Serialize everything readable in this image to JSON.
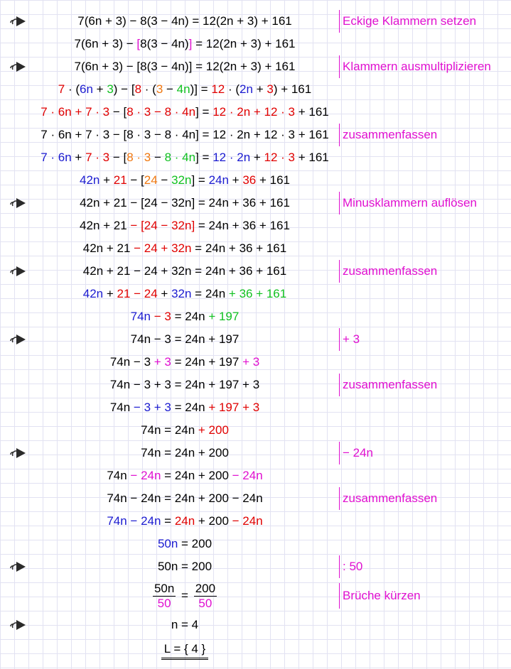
{
  "colors": {
    "black": "#000000",
    "red": "#e00000",
    "blue": "#1a1ad0",
    "green": "#10c020",
    "orange": "#f07810",
    "magenta": "#e010d0",
    "grid": "#e2e2f2",
    "icon": "#2a2a2a"
  },
  "rows": [
    {
      "icon": true,
      "segs": [
        [
          "7(6n + 3) − 8(3 − 4n) = 12(2n + 3) + 161",
          "black"
        ]
      ],
      "ann": "Eckige Klammern setzen"
    },
    {
      "icon": false,
      "segs": [
        [
          "7(6n + 3) − ",
          "black"
        ],
        [
          "[",
          "magenta"
        ],
        [
          "8(3 − 4n)",
          "black"
        ],
        [
          "]",
          "magenta"
        ],
        [
          " = 12(2n + 3) + 161",
          "black"
        ]
      ],
      "ann": ""
    },
    {
      "icon": true,
      "segs": [
        [
          "7(6n + 3) − [8(3 − 4n)] = 12(2n + 3) + 161",
          "black"
        ]
      ],
      "ann": "Klammern ausmultiplizieren"
    },
    {
      "icon": false,
      "segs": [
        [
          "7",
          "red"
        ],
        [
          " · (",
          "black"
        ],
        [
          "6n",
          "blue"
        ],
        [
          " + ",
          "black"
        ],
        [
          "3",
          "green"
        ],
        [
          ") − [",
          "black"
        ],
        [
          "8",
          "red"
        ],
        [
          " · (",
          "black"
        ],
        [
          "3",
          "orange"
        ],
        [
          " − ",
          "black"
        ],
        [
          "4n",
          "green"
        ],
        [
          ")] = ",
          "black"
        ],
        [
          "12",
          "red"
        ],
        [
          " · (",
          "black"
        ],
        [
          "2n",
          "blue"
        ],
        [
          " + ",
          "black"
        ],
        [
          "3",
          "red"
        ],
        [
          ") + 161",
          "black"
        ]
      ],
      "ann": ""
    },
    {
      "icon": false,
      "segs": [
        [
          "7 · 6n + 7 · 3",
          "red"
        ],
        [
          " − [",
          "black"
        ],
        [
          "8 · 3 − 8 · 4n",
          "red"
        ],
        [
          "] = ",
          "black"
        ],
        [
          "12 · 2n + 12 · 3",
          "red"
        ],
        [
          " + 161",
          "black"
        ]
      ],
      "ann": ""
    },
    {
      "icon": false,
      "segs": [
        [
          "7 · 6n + 7 · 3 − [8 · 3 − 8 · 4n] = 12 · 2n + 12 · 3 + 161",
          "black"
        ]
      ],
      "ann": "zusammenfassen"
    },
    {
      "icon": false,
      "segs": [
        [
          "7 · 6n",
          "blue"
        ],
        [
          " + ",
          "black"
        ],
        [
          "7 · 3",
          "red"
        ],
        [
          " − [",
          "black"
        ],
        [
          "8 · 3",
          "orange"
        ],
        [
          " − ",
          "black"
        ],
        [
          "8 · 4n",
          "green"
        ],
        [
          "] = ",
          "black"
        ],
        [
          "12 · 2n",
          "blue"
        ],
        [
          " + ",
          "black"
        ],
        [
          "12 · 3",
          "red"
        ],
        [
          " + 161",
          "black"
        ]
      ],
      "ann": ""
    },
    {
      "icon": false,
      "segs": [
        [
          "42n",
          "blue"
        ],
        [
          " + ",
          "black"
        ],
        [
          "21",
          "red"
        ],
        [
          " − [",
          "black"
        ],
        [
          "24",
          "orange"
        ],
        [
          " − ",
          "black"
        ],
        [
          "32n",
          "green"
        ],
        [
          "] = ",
          "black"
        ],
        [
          "24n",
          "blue"
        ],
        [
          " + ",
          "black"
        ],
        [
          "36",
          "red"
        ],
        [
          " + 161",
          "black"
        ]
      ],
      "ann": ""
    },
    {
      "icon": true,
      "segs": [
        [
          "42n + 21 − [24 − 32n] = 24n + 36 + 161",
          "black"
        ]
      ],
      "ann": "Minusklammern auflösen"
    },
    {
      "icon": false,
      "segs": [
        [
          "42n + 21 ",
          "black"
        ],
        [
          "− [24 − 32n]",
          "red"
        ],
        [
          " = 24n + 36 + 161",
          "black"
        ]
      ],
      "ann": ""
    },
    {
      "icon": false,
      "segs": [
        [
          "42n + 21 ",
          "black"
        ],
        [
          "− 24 + 32n",
          "red"
        ],
        [
          " = 24n + 36 + 161",
          "black"
        ]
      ],
      "ann": ""
    },
    {
      "icon": true,
      "segs": [
        [
          "42n + 21 − 24 + 32n = 24n + 36 + 161",
          "black"
        ]
      ],
      "ann": "zusammenfassen"
    },
    {
      "icon": false,
      "segs": [
        [
          "42n",
          "blue"
        ],
        [
          " + ",
          "black"
        ],
        [
          "21 − 24",
          "red"
        ],
        [
          " + ",
          "black"
        ],
        [
          "32n",
          "blue"
        ],
        [
          " = 24n ",
          "black"
        ],
        [
          "+ 36 + 161",
          "green"
        ]
      ],
      "ann": ""
    },
    {
      "icon": false,
      "segs": [
        [
          "74n",
          "blue"
        ],
        [
          " ",
          "black"
        ],
        [
          "− 3",
          "red"
        ],
        [
          " = 24n ",
          "black"
        ],
        [
          "+ 197",
          "green"
        ]
      ],
      "ann": ""
    },
    {
      "icon": true,
      "segs": [
        [
          "74n − 3 = 24n + 197",
          "black"
        ]
      ],
      "ann": "+ 3"
    },
    {
      "icon": false,
      "segs": [
        [
          "74n − 3 ",
          "black"
        ],
        [
          "+ 3",
          "magenta"
        ],
        [
          " = 24n + 197 ",
          "black"
        ],
        [
          "+ 3",
          "magenta"
        ]
      ],
      "ann": ""
    },
    {
      "icon": false,
      "segs": [
        [
          "74n − 3 + 3 = 24n + 197 + 3",
          "black"
        ]
      ],
      "ann": "zusammenfassen"
    },
    {
      "icon": false,
      "segs": [
        [
          "74n ",
          "black"
        ],
        [
          "− 3 + 3",
          "blue"
        ],
        [
          " = 24n ",
          "black"
        ],
        [
          "+ 197 + 3",
          "red"
        ]
      ],
      "ann": ""
    },
    {
      "icon": false,
      "segs": [
        [
          "74n = 24n ",
          "black"
        ],
        [
          "+ 200",
          "red"
        ]
      ],
      "ann": ""
    },
    {
      "icon": true,
      "segs": [
        [
          "74n = 24n + 200",
          "black"
        ]
      ],
      "ann": "− 24n"
    },
    {
      "icon": false,
      "segs": [
        [
          "74n ",
          "black"
        ],
        [
          "− 24n",
          "magenta"
        ],
        [
          " = 24n + 200 ",
          "black"
        ],
        [
          "− 24n",
          "magenta"
        ]
      ],
      "ann": ""
    },
    {
      "icon": false,
      "segs": [
        [
          "74n − 24n = 24n + 200 − 24n",
          "black"
        ]
      ],
      "ann": "zusammenfassen"
    },
    {
      "icon": false,
      "segs": [
        [
          "74n − 24n",
          "blue"
        ],
        [
          " = ",
          "black"
        ],
        [
          "24n",
          "red"
        ],
        [
          " + 200 ",
          "black"
        ],
        [
          "− 24n",
          "red"
        ]
      ],
      "ann": ""
    },
    {
      "icon": false,
      "segs": [
        [
          "50n",
          "blue"
        ],
        [
          " = 200",
          "black"
        ]
      ],
      "ann": ""
    },
    {
      "icon": true,
      "segs": [
        [
          "50n = 200",
          "black"
        ]
      ],
      "ann": ": 50"
    }
  ],
  "fraction_row": {
    "left_num": "50n",
    "left_den": "50",
    "eq": " = ",
    "right_num": "200",
    "right_den": "50",
    "ann": "Brüche kürzen"
  },
  "solution_row": {
    "text": "n = 4"
  },
  "result_row": {
    "text": "L = { 4 }"
  }
}
